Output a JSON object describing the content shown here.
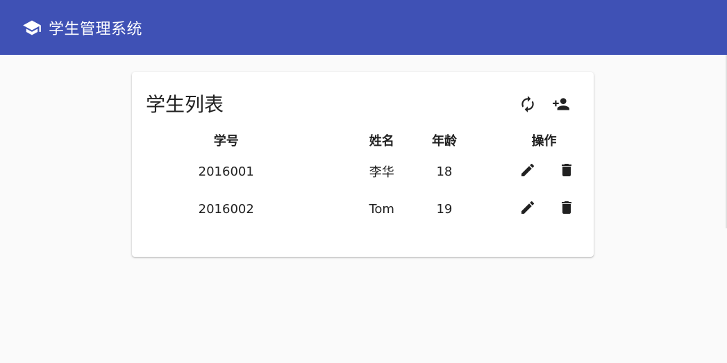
{
  "app": {
    "title": "学生管理系统",
    "bar_color": "#3f51b5",
    "logo_icon": "school-icon"
  },
  "card": {
    "title": "学生列表",
    "toolbar": {
      "refresh_icon": "refresh-icon",
      "add_icon": "person-add-icon"
    }
  },
  "table": {
    "headers": [
      "学号",
      "姓名",
      "年龄",
      "操作"
    ],
    "rows": [
      {
        "id": "2016001",
        "name": "李华",
        "age": "18",
        "edit_icon": "edit-icon",
        "delete_icon": "delete-icon"
      },
      {
        "id": "2016002",
        "name": "Tom",
        "age": "19",
        "edit_icon": "edit-icon",
        "delete_icon": "delete-icon"
      }
    ]
  }
}
